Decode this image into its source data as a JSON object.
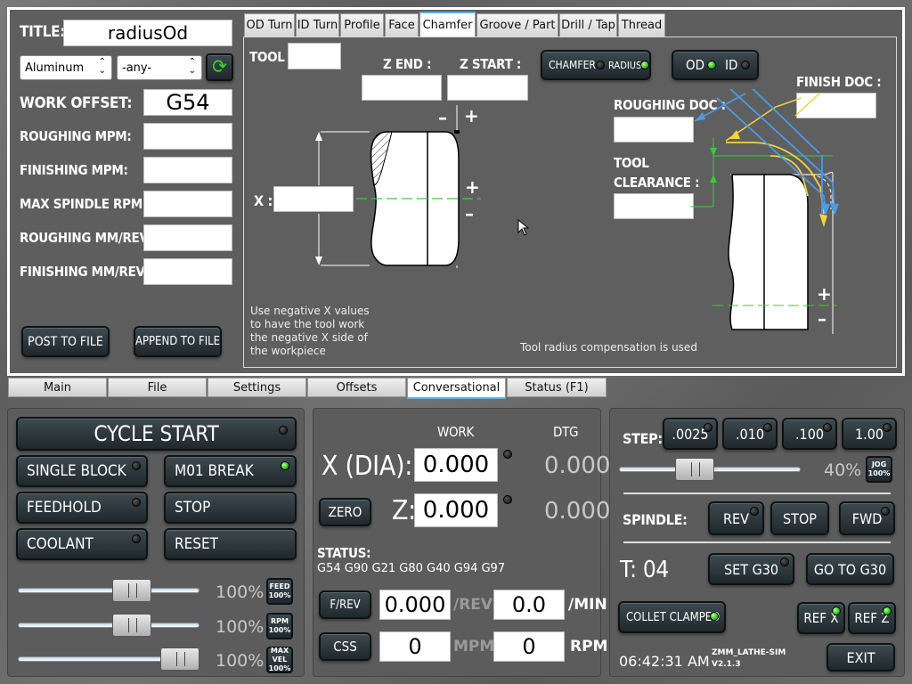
{
  "setup": {
    "title_label": "TITLE:",
    "title_value": "radiusOd",
    "material": "Aluminum",
    "tool_select": "-any-",
    "work_offset_label": "WORK OFFSET:",
    "work_offset_value": "G54",
    "roughing_mpm_label": "ROUGHING MPM:",
    "finishing_mpm_label": "FINISHING MPM:",
    "max_rpm_label": "MAX SPINDLE RPM:",
    "roughing_feed_label": "ROUGHING MM/REV:",
    "finishing_feed_label": "FINISHING MM/REV:",
    "post_button": "POST TO FILE",
    "append_button": "APPEND TO FILE"
  },
  "op_tabs": [
    "OD Turn",
    "ID Turn",
    "Profile",
    "Face",
    "Chamfer",
    "Groove / Part",
    "Drill / Tap",
    "Thread"
  ],
  "op_active": "Chamfer",
  "chamfer": {
    "tool_label": "TOOL :",
    "z_end_label": "Z END :",
    "z_start_label": "Z START :",
    "x_label": "X :",
    "chamfer_radius_left": "CHAMFER",
    "chamfer_radius_right": "RADIUS",
    "od": "OD",
    "id": "ID",
    "roughing_doc_label": "ROUGHING DOC :",
    "finish_doc_label": "FINISH DOC :",
    "tool_clearance_label1": "TOOL",
    "tool_clearance_label2": "CLEARANCE :",
    "minus": "–",
    "plus": "+",
    "note": "Use negative X values to have the tool work the negative X side of the workpiece",
    "comp_note": "Tool radius compensation is used"
  },
  "main_tabs": [
    "Main",
    "File",
    "Settings",
    "Offsets",
    "Conversational",
    "Status (F1)"
  ],
  "main_active": "Conversational",
  "controls": {
    "cycle_start": "CYCLE START",
    "single_block": "SINGLE BLOCK",
    "m01_break": "M01 BREAK",
    "feedhold": "FEEDHOLD",
    "stop": "STOP",
    "coolant": "COOLANT",
    "reset": "RESET",
    "feed_pct": "100%",
    "rpm_pct": "100%",
    "maxvel_pct": "100%",
    "feed_mini": [
      "FEED",
      "100%"
    ],
    "rpm_mini": [
      "RPM",
      "100%"
    ],
    "maxvel_mini": [
      "MAX VEL",
      "100%"
    ],
    "feed_override": 1.0,
    "rpm_override": 1.0,
    "maxvel_override": 1.0
  },
  "dro": {
    "work_header": "WORK",
    "dtg_header": "DTG",
    "x_label": "X (DIA):",
    "z_label": "Z:",
    "x_work": "0.000",
    "x_dtg": "0.000",
    "z_work": "0.000",
    "z_dtg": "0.000",
    "zero_button": "ZERO",
    "status_label": "STATUS:",
    "status_text": "G54 G90 G21 G80 G40 G94 G97",
    "frev_button": "F/REV",
    "feed_rev": "0.000",
    "rev_unit": "/REV",
    "feed_min": "0.0",
    "min_unit": "/MIN",
    "css_button": "CSS",
    "css_value": "0",
    "mpm_unit": "MPM",
    "rpm_value": "0",
    "rpm_unit": "RPM"
  },
  "jog": {
    "step_label": "STEP:",
    "steps": [
      ".0025",
      ".010",
      ".100",
      "1.00"
    ],
    "jog_pct": "40%",
    "jog_mini": [
      "JOG",
      "100%"
    ],
    "jog_level": 0.4,
    "spindle_label": "SPINDLE:",
    "rev": "REV",
    "stop": "STOP",
    "fwd": "FWD",
    "tool_label": "T: 04",
    "set_g30": "SET G30",
    "go_g30": "GO TO G30",
    "collet": "COLLET CLAMPED",
    "ref_x": "REF X",
    "ref_z": "REF Z",
    "time": "06:42:31 AM",
    "machine": "ZMM_LATHE-SIM",
    "version": "V2.1.3",
    "exit": "EXIT"
  }
}
